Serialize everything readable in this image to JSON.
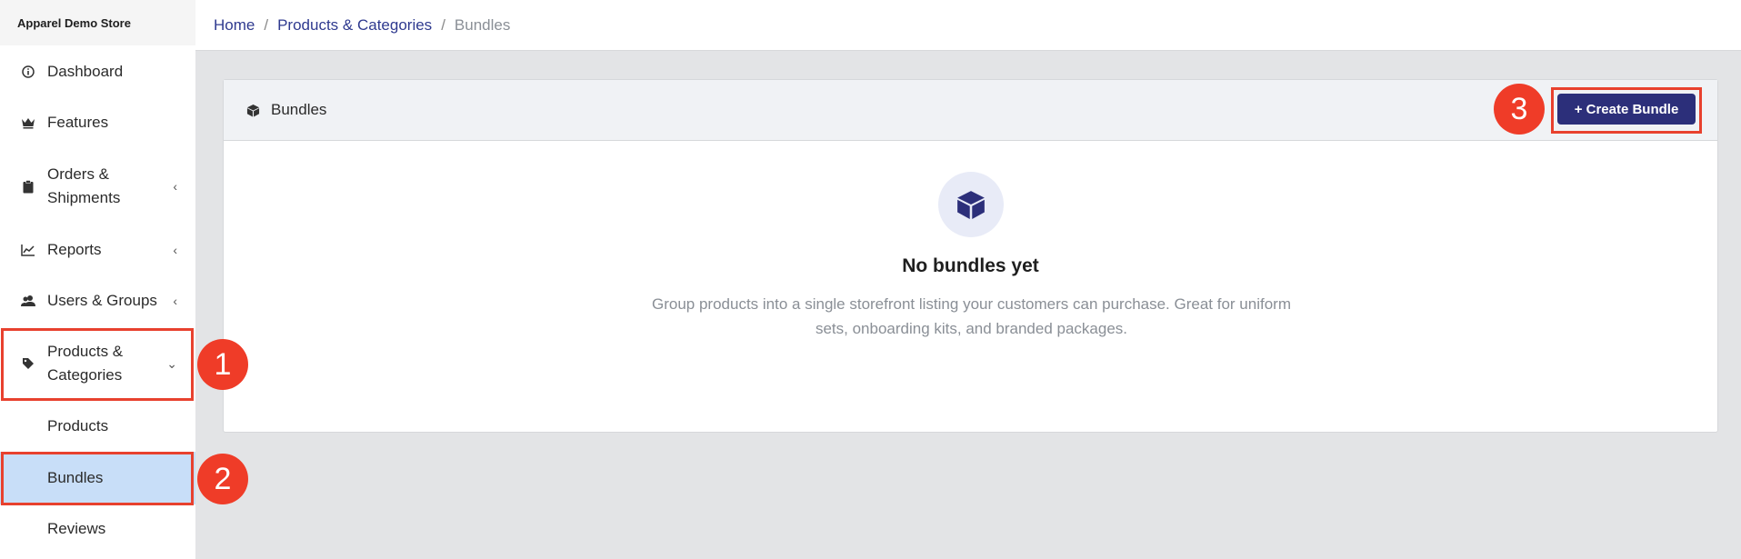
{
  "sidebar": {
    "brand": "Apparel Demo Store",
    "items": [
      {
        "label": "Dashboard",
        "icon": "info-circle-icon"
      },
      {
        "label": "Features",
        "icon": "crown-icon"
      },
      {
        "label": "Orders & Shipments",
        "line1": "Orders &",
        "line2": "Shipments",
        "icon": "clipboard-icon",
        "chevron": "‹"
      },
      {
        "label": "Reports",
        "icon": "line-chart-icon",
        "chevron": "‹"
      },
      {
        "label": "Users & Groups",
        "icon": "users-icon",
        "chevron": "‹"
      },
      {
        "label": "Products & Categories",
        "line1": "Products &",
        "line2": "Categories",
        "icon": "tag-icon",
        "chevron": "⌄"
      }
    ],
    "sub_items": [
      {
        "label": "Products"
      },
      {
        "label": "Bundles",
        "active": true
      },
      {
        "label": "Reviews"
      }
    ]
  },
  "breadcrumb": {
    "home": "Home",
    "sep": "/",
    "section": "Products & Categories",
    "current": "Bundles"
  },
  "card": {
    "title": "Bundles",
    "icon": "box-icon",
    "create_button": "+ Create Bundle",
    "empty_title": "No bundles yet",
    "empty_text": "Group products into a single storefront listing your customers can purchase. Great for uniform sets, onboarding kits, and branded packages."
  },
  "annotations": [
    "1",
    "2",
    "3"
  ],
  "colors": {
    "accent": "#2c2f7a",
    "link": "#2f3a8f",
    "active_bg": "#c8def8",
    "annotation": "#ef3c28"
  }
}
